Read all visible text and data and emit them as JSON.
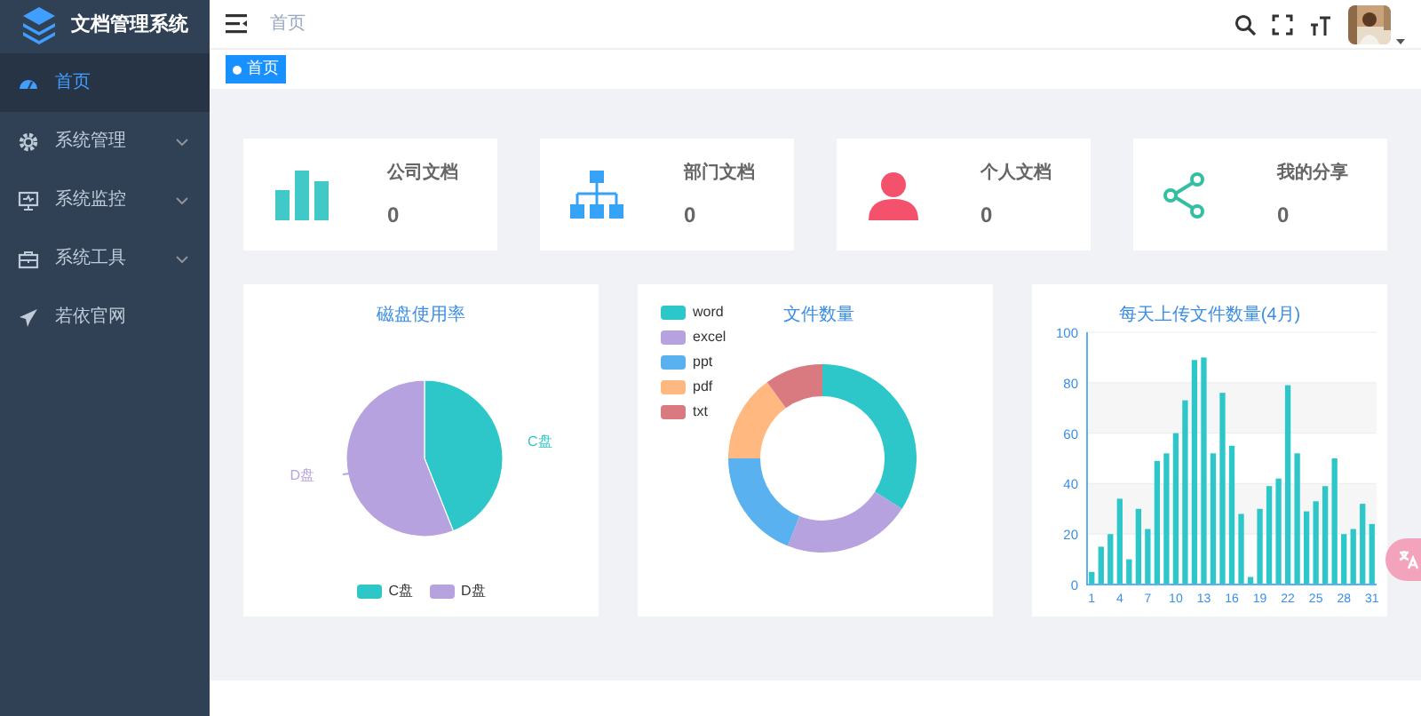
{
  "sidebar": {
    "title": "文档管理系统",
    "items": [
      {
        "label": "首页",
        "selected": true,
        "expandable": false
      },
      {
        "label": "系统管理",
        "selected": false,
        "expandable": true
      },
      {
        "label": "系统监控",
        "selected": false,
        "expandable": true
      },
      {
        "label": "系统工具",
        "selected": false,
        "expandable": true
      },
      {
        "label": "若依官网",
        "selected": false,
        "expandable": false
      }
    ]
  },
  "header": {
    "breadcrumb": "首页"
  },
  "tags": [
    {
      "label": "首页",
      "selected": true
    }
  ],
  "stat_cards": [
    {
      "label": "公司文档",
      "value": "0"
    },
    {
      "label": "部门文档",
      "value": "0"
    },
    {
      "label": "个人文档",
      "value": "0"
    },
    {
      "label": "我的分享",
      "value": "0"
    }
  ],
  "disk_chart": {
    "title": "磁盘使用率",
    "slices": [
      {
        "label": "C盘",
        "color": "#2ec7c9"
      },
      {
        "label": "D盘",
        "color": "#b6a2de"
      }
    ],
    "legend": [
      {
        "label": "C盘",
        "color": "#2ec7c9"
      },
      {
        "label": "D盘",
        "color": "#b6a2de"
      }
    ]
  },
  "file_chart": {
    "title": "文件数量",
    "slices": [
      {
        "label": "word",
        "color": "#2ec7c9"
      },
      {
        "label": "excel",
        "color": "#b6a2de"
      },
      {
        "label": "ppt",
        "color": "#5ab1ef"
      },
      {
        "label": "pdf",
        "color": "#ffb980"
      },
      {
        "label": "txt",
        "color": "#d87a80"
      }
    ]
  },
  "upload_chart": {
    "chart_data": {
      "type": "bar",
      "title": "每天上传文件数量(4月)",
      "x": [
        1,
        2,
        3,
        4,
        5,
        6,
        7,
        8,
        9,
        10,
        11,
        12,
        13,
        14,
        15,
        16,
        17,
        18,
        19,
        20,
        21,
        22,
        23,
        24,
        25,
        26,
        27,
        28,
        29,
        30,
        31
      ],
      "series": [
        {
          "color": "#2ec7c9",
          "values": [
            5,
            15,
            20,
            34,
            10,
            30,
            22,
            49,
            52,
            60,
            73,
            89,
            90,
            52,
            76,
            55,
            28,
            3,
            30,
            39,
            42,
            79,
            52,
            29,
            33,
            39,
            50,
            20,
            22,
            32,
            24
          ]
        }
      ],
      "xlim": [
        0.5,
        31.5
      ],
      "ylim": [
        0,
        100
      ],
      "yticks": [
        0,
        20,
        40,
        60,
        80,
        100
      ],
      "xticks": [
        1,
        4,
        7,
        10,
        13,
        16,
        19,
        22,
        25,
        28,
        31
      ],
      "grid": true
    }
  }
}
